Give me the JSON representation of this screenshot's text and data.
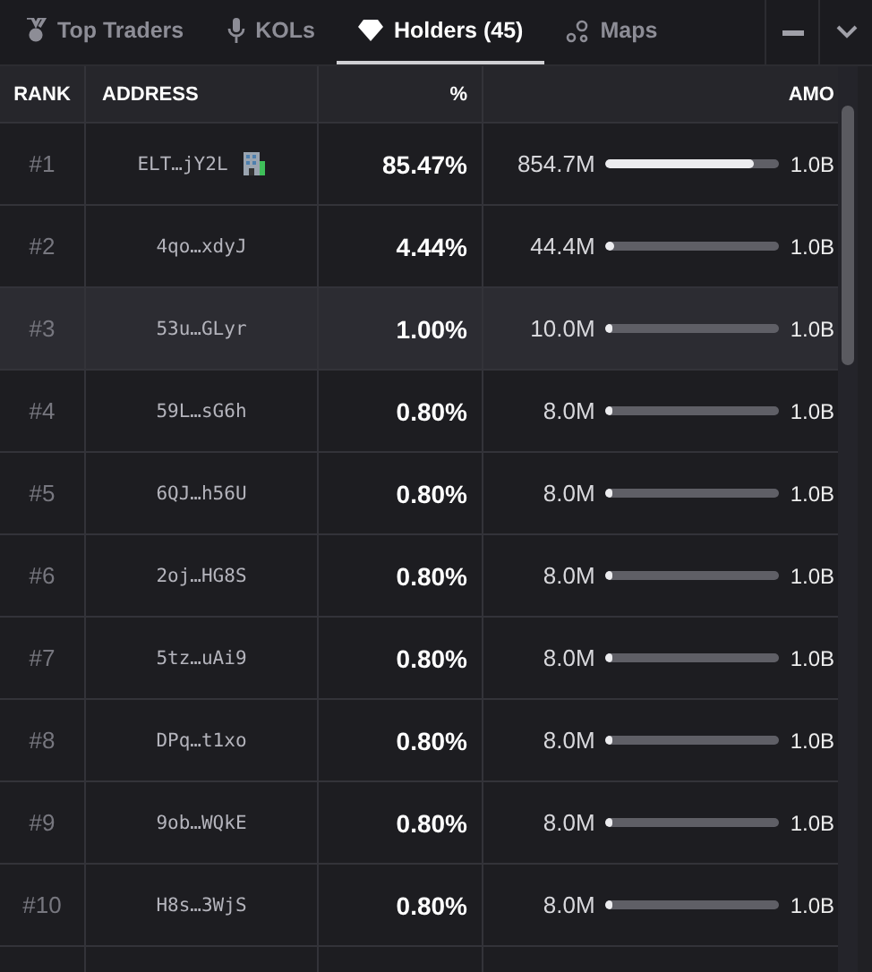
{
  "tabs": [
    {
      "label": "Top Traders",
      "selected": false
    },
    {
      "label": "KOLs",
      "selected": false
    },
    {
      "label": "Holders (45)",
      "selected": true
    },
    {
      "label": "Maps",
      "selected": false
    }
  ],
  "table": {
    "columns": [
      "RANK",
      "ADDRESS",
      "%",
      "AMO"
    ],
    "rows": [
      {
        "rank": "#1",
        "address": "ELT…jY2L",
        "tagged": true,
        "percent": "85.47%",
        "amount": "854.7M",
        "level": 0.855,
        "total": "1.0B",
        "selected": false
      },
      {
        "rank": "#2",
        "address": "4qo…xdyJ",
        "tagged": false,
        "percent": "4.44%",
        "amount": "44.4M",
        "level": 0.044,
        "total": "1.0B",
        "selected": false
      },
      {
        "rank": "#3",
        "address": "53u…GLyr",
        "tagged": false,
        "percent": "1.00%",
        "amount": "10.0M",
        "level": 0.01,
        "total": "1.0B",
        "selected": true
      },
      {
        "rank": "#4",
        "address": "59L…sG6h",
        "tagged": false,
        "percent": "0.80%",
        "amount": "8.0M",
        "level": 0.008,
        "total": "1.0B",
        "selected": false
      },
      {
        "rank": "#5",
        "address": "6QJ…h56U",
        "tagged": false,
        "percent": "0.80%",
        "amount": "8.0M",
        "level": 0.008,
        "total": "1.0B",
        "selected": false
      },
      {
        "rank": "#6",
        "address": "2oj…HG8S",
        "tagged": false,
        "percent": "0.80%",
        "amount": "8.0M",
        "level": 0.008,
        "total": "1.0B",
        "selected": false
      },
      {
        "rank": "#7",
        "address": "5tz…uAi9",
        "tagged": false,
        "percent": "0.80%",
        "amount": "8.0M",
        "level": 0.008,
        "total": "1.0B",
        "selected": false
      },
      {
        "rank": "#8",
        "address": "DPq…t1xo",
        "tagged": false,
        "percent": "0.80%",
        "amount": "8.0M",
        "level": 0.008,
        "total": "1.0B",
        "selected": false
      },
      {
        "rank": "#9",
        "address": "9ob…WQkE",
        "tagged": false,
        "percent": "0.80%",
        "amount": "8.0M",
        "level": 0.008,
        "total": "1.0B",
        "selected": false
      },
      {
        "rank": "#10",
        "address": "H8s…3WjS",
        "tagged": false,
        "percent": "0.80%",
        "amount": "8.0M",
        "level": 0.008,
        "total": "1.0B",
        "selected": false
      }
    ]
  }
}
